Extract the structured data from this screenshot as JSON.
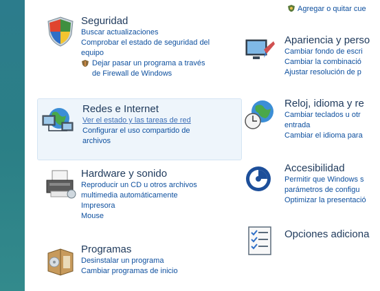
{
  "left_column": {
    "security": {
      "title": "Seguridad",
      "links": [
        "Buscar actualizaciones",
        "Comprobar el estado de seguridad del",
        "equipo"
      ],
      "firewall_link": [
        "Dejar pasar un programa a través",
        "de Firewall de Windows"
      ]
    },
    "network": {
      "title": "Redes e Internet",
      "links": [
        "Ver el estado y las tareas de red",
        "Configurar el uso compartido de",
        "archivos"
      ]
    },
    "hardware": {
      "title": "Hardware y sonido",
      "links": [
        "Reproducir un CD u otros archivos",
        "multimedia automáticamente",
        "Impresora",
        "Mouse"
      ]
    },
    "programs": {
      "title": "Programas",
      "links": [
        "Desinstalar un programa",
        "Cambiar programas de inicio"
      ]
    }
  },
  "right_column": {
    "top_link": "Agregar o quitar cue",
    "appearance": {
      "title": "Apariencia y perso",
      "links": [
        "Cambiar fondo de escri",
        "Cambiar la combinació",
        "Ajustar resolución de p"
      ]
    },
    "clock": {
      "title": "Reloj, idioma y re",
      "links": [
        "Cambiar teclados u otr",
        "entrada",
        "Cambiar el idioma para"
      ]
    },
    "accessibility": {
      "title": "Accesibilidad",
      "links": [
        "Permitir que Windows s",
        "parámetros de configu",
        "Optimizar la presentació"
      ]
    },
    "additional": {
      "title": "Opciones adiciona"
    }
  },
  "colors": {
    "sidebar": "#2c7c8c",
    "title": "#1e395b",
    "link": "#0d4f9e",
    "highlight": "#eef5fb"
  }
}
